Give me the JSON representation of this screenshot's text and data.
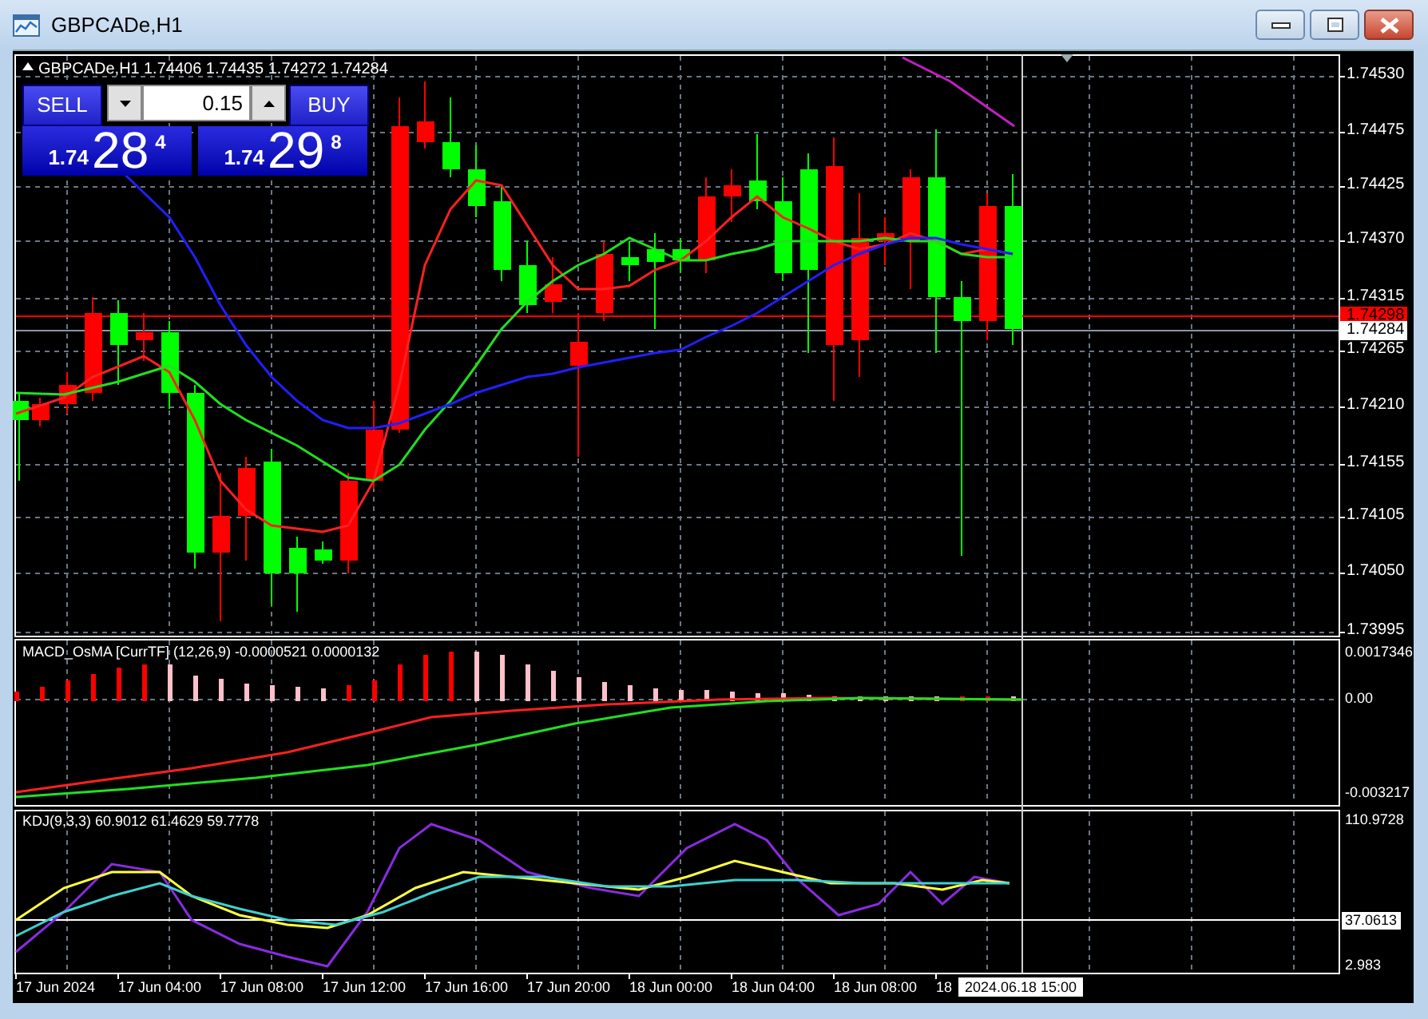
{
  "window": {
    "title": "GBPCADe,H1"
  },
  "chart": {
    "symbol": "GBPCADe,H1",
    "ohlc": "1.74406 1.74435 1.74272 1.74284"
  },
  "trade_panel": {
    "sell_label": "SELL",
    "buy_label": "BUY",
    "volume": "0.15",
    "sell_price": {
      "prefix": "1.74",
      "big": "28",
      "small": "4"
    },
    "buy_price": {
      "prefix": "1.74",
      "big": "29",
      "small": "8"
    }
  },
  "price_axis": [
    "1.74530",
    "1.74475",
    "1.74425",
    "1.74370",
    "1.74315",
    "1.74265",
    "1.74210",
    "1.74155",
    "1.74105",
    "1.74050",
    "1.73995"
  ],
  "price_lines": [
    {
      "label": "1.74298",
      "kind": "bid"
    },
    {
      "label": "1.74284",
      "kind": "last"
    }
  ],
  "macd": {
    "label": "MACD_OsMA [CurrTF] (12,26,9) -0.0000521 0.0000132",
    "axis": [
      "0.0017346",
      "0.00",
      "-0.003217"
    ]
  },
  "kdj": {
    "label": "KDJ(9,3,3) 60.9012 61.4629 59.7778",
    "axis": [
      "110.9728",
      "2.983"
    ],
    "level_label": "37.0613"
  },
  "time_axis": [
    "17 Jun 2024",
    "17 Jun 04:00",
    "17 Jun 08:00",
    "17 Jun 12:00",
    "17 Jun 16:00",
    "17 Jun 20:00",
    "18 Jun 00:00",
    "18 Jun 04:00",
    "18 Jun 08:00",
    "18"
  ],
  "crosshair_time": "2024.06.18 15:00"
}
